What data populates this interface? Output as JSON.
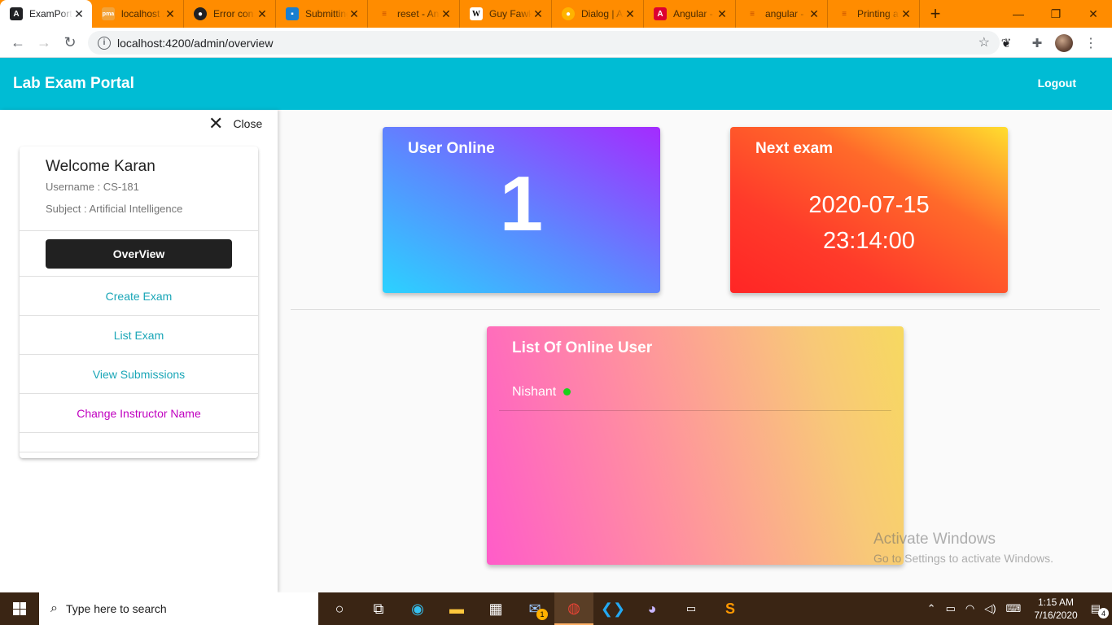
{
  "browser": {
    "tabs": [
      {
        "label": "ExamPortal",
        "icon": "angular-icon",
        "color": "#202124"
      },
      {
        "label": "localhost / localhost / ...",
        "icon": "phpmyadmin-icon",
        "color": "#f2a33a"
      },
      {
        "label": "Error con",
        "icon": "github-icon",
        "color": "#202124"
      },
      {
        "label": "Submitting",
        "icon": "bitwarden-icon",
        "color": "#1a7fd1"
      },
      {
        "label": "reset - An",
        "icon": "stackoverflow-icon",
        "color": "#f48024"
      },
      {
        "label": "Guy Fawkes",
        "icon": "wikipedia-icon",
        "color": "#ffffff"
      },
      {
        "label": "Dialog | A",
        "icon": "material-icon",
        "color": "#ffb300"
      },
      {
        "label": "Angular -",
        "icon": "angular-icon",
        "color": "#dd0031"
      },
      {
        "label": "angular -",
        "icon": "stackoverflow-icon",
        "color": "#f48024"
      },
      {
        "label": "Printing a",
        "icon": "stackoverflow-icon",
        "color": "#f48024"
      }
    ],
    "url": "localhost:4200/admin/overview"
  },
  "header": {
    "title": "Lab Exam Portal",
    "logout_label": "Logout"
  },
  "sidebar": {
    "close_label": "Close",
    "welcome": "Welcome Karan",
    "username": "Username : CS-181",
    "subject": "Subject : Artificial Intelligence",
    "items": [
      {
        "label": "OverView",
        "active": true
      },
      {
        "label": "Create Exam"
      },
      {
        "label": "List Exam"
      },
      {
        "label": "View Submissions"
      },
      {
        "label": "Change Instructor Name"
      }
    ]
  },
  "cards": {
    "online": {
      "title": "User Online",
      "count": "1"
    },
    "next_exam": {
      "title": "Next exam",
      "date": "2020-07-15",
      "time": "23:14:00"
    },
    "online_list": {
      "title": "List Of Online User",
      "users": [
        "Nishant"
      ]
    }
  },
  "watermark": {
    "line1": "Activate Windows",
    "line2": "Go to Settings to activate Windows."
  },
  "taskbar": {
    "search_placeholder": "Type here to search",
    "mail_badge": "1",
    "notification_badge": "4",
    "time": "1:15 AM",
    "date": "7/16/2020"
  },
  "colors": {
    "appbar": "#00bcd4",
    "nav_link": "#1aa6b7",
    "nav_magenta": "#c000c0",
    "online_dot": "#1ad11a"
  }
}
